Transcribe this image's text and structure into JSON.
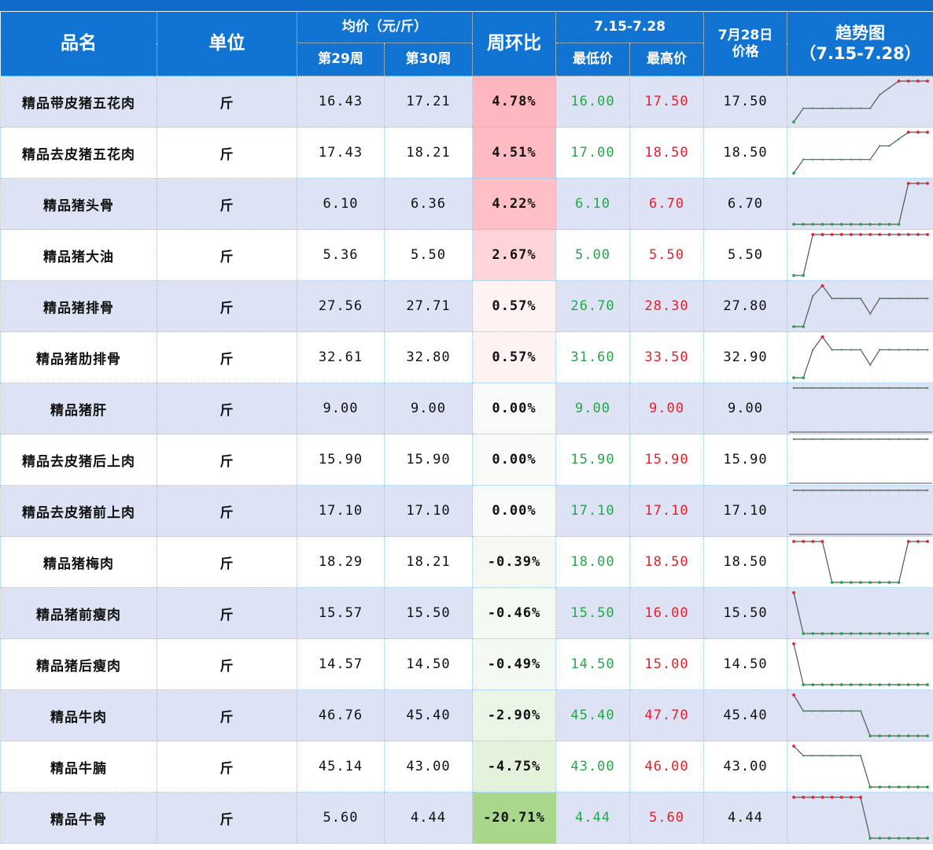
{
  "header": {
    "name": "品名",
    "unit": "单位",
    "avg": "均价（元/斤）",
    "week29": "第29周",
    "week30": "第30周",
    "change": "周环比",
    "range": "7.15-7.28",
    "min": "最低价",
    "max": "最高价",
    "day_line1": "7月28日",
    "day_line2": "价格",
    "trend_line1": "趋势图",
    "trend_line2": "（7.15-7.28）"
  },
  "colors": {
    "header_bg": "#1174d3",
    "row_band": "#dde3f4",
    "min_price": "#22a849",
    "max_price": "#e5202a",
    "positive_change": "#f5b3bb",
    "negative_change": "#a8d88a"
  },
  "rows": [
    {
      "name": "精品带皮猪五花肉",
      "unit": "斤",
      "w29": "16.43",
      "w30": "17.21",
      "change": "4.78%",
      "min": "16.00",
      "max": "17.50",
      "day": "17.50",
      "trend": [
        16.0,
        16.5,
        16.5,
        16.5,
        16.5,
        16.5,
        16.5,
        16.5,
        16.5,
        17.0,
        17.25,
        17.5,
        17.5,
        17.5,
        17.5
      ]
    },
    {
      "name": "精品去皮猪五花肉",
      "unit": "斤",
      "w29": "17.43",
      "w30": "18.21",
      "change": "4.51%",
      "min": "17.00",
      "max": "18.50",
      "day": "18.50",
      "trend": [
        17.0,
        17.5,
        17.5,
        17.5,
        17.5,
        17.5,
        17.5,
        17.5,
        17.5,
        18.0,
        18.0,
        18.25,
        18.5,
        18.5,
        18.5
      ]
    },
    {
      "name": "精品猪头骨",
      "unit": "斤",
      "w29": "6.10",
      "w30": "6.36",
      "change": "4.22%",
      "min": "6.10",
      "max": "6.70",
      "day": "6.70",
      "trend": [
        6.1,
        6.1,
        6.1,
        6.1,
        6.1,
        6.1,
        6.1,
        6.1,
        6.1,
        6.1,
        6.1,
        6.1,
        6.7,
        6.7,
        6.7
      ]
    },
    {
      "name": "精品猪大油",
      "unit": "斤",
      "w29": "5.36",
      "w30": "5.50",
      "change": "2.67%",
      "min": "5.00",
      "max": "5.50",
      "day": "5.50",
      "trend": [
        5.0,
        5.0,
        5.5,
        5.5,
        5.5,
        5.5,
        5.5,
        5.5,
        5.5,
        5.5,
        5.5,
        5.5,
        5.5,
        5.5,
        5.5
      ]
    },
    {
      "name": "精品猪排骨",
      "unit": "斤",
      "w29": "27.56",
      "w30": "27.71",
      "change": "0.57%",
      "min": "26.70",
      "max": "28.30",
      "day": "27.80",
      "trend": [
        26.7,
        26.7,
        27.9,
        28.3,
        27.8,
        27.8,
        27.8,
        27.8,
        27.2,
        27.8,
        27.8,
        27.8,
        27.8,
        27.8,
        27.8
      ]
    },
    {
      "name": "精品猪肋排骨",
      "unit": "斤",
      "w29": "32.61",
      "w30": "32.80",
      "change": "0.57%",
      "min": "31.60",
      "max": "33.50",
      "day": "32.90",
      "trend": [
        31.6,
        31.6,
        32.9,
        33.5,
        32.9,
        32.9,
        32.9,
        32.9,
        32.2,
        32.9,
        32.9,
        32.9,
        32.9,
        32.9,
        32.9
      ]
    },
    {
      "name": "精品猪肝",
      "unit": "斤",
      "w29": "9.00",
      "w30": "9.00",
      "change": "0.00%",
      "min": "9.00",
      "max": "9.00",
      "day": "9.00",
      "trend": [
        9.0,
        9.0,
        9.0,
        9.0,
        9.0,
        9.0,
        9.0,
        9.0,
        9.0,
        9.0,
        9.0,
        9.0,
        9.0,
        9.0,
        9.0
      ]
    },
    {
      "name": "精品去皮猪后上肉",
      "unit": "斤",
      "w29": "15.90",
      "w30": "15.90",
      "change": "0.00%",
      "min": "15.90",
      "max": "15.90",
      "day": "15.90",
      "trend": [
        15.9,
        15.9,
        15.9,
        15.9,
        15.9,
        15.9,
        15.9,
        15.9,
        15.9,
        15.9,
        15.9,
        15.9,
        15.9,
        15.9,
        15.9
      ]
    },
    {
      "name": "精品去皮猪前上肉",
      "unit": "斤",
      "w29": "17.10",
      "w30": "17.10",
      "change": "0.00%",
      "min": "17.10",
      "max": "17.10",
      "day": "17.10",
      "trend": [
        17.1,
        17.1,
        17.1,
        17.1,
        17.1,
        17.1,
        17.1,
        17.1,
        17.1,
        17.1,
        17.1,
        17.1,
        17.1,
        17.1,
        17.1
      ]
    },
    {
      "name": "精品猪梅肉",
      "unit": "斤",
      "w29": "18.29",
      "w30": "18.21",
      "change": "-0.39%",
      "min": "18.00",
      "max": "18.50",
      "day": "18.50",
      "trend": [
        18.5,
        18.5,
        18.5,
        18.5,
        18.0,
        18.0,
        18.0,
        18.0,
        18.0,
        18.0,
        18.0,
        18.0,
        18.5,
        18.5,
        18.5
      ]
    },
    {
      "name": "精品猪前瘦肉",
      "unit": "斤",
      "w29": "15.57",
      "w30": "15.50",
      "change": "-0.46%",
      "min": "15.50",
      "max": "16.00",
      "day": "15.50",
      "trend": [
        16.0,
        15.5,
        15.5,
        15.5,
        15.5,
        15.5,
        15.5,
        15.5,
        15.5,
        15.5,
        15.5,
        15.5,
        15.5,
        15.5,
        15.5
      ]
    },
    {
      "name": "精品猪后瘦肉",
      "unit": "斤",
      "w29": "14.57",
      "w30": "14.50",
      "change": "-0.49%",
      "min": "14.50",
      "max": "15.00",
      "day": "14.50",
      "trend": [
        15.0,
        14.5,
        14.5,
        14.5,
        14.5,
        14.5,
        14.5,
        14.5,
        14.5,
        14.5,
        14.5,
        14.5,
        14.5,
        14.5,
        14.5
      ]
    },
    {
      "name": "精品牛肉",
      "unit": "斤",
      "w29": "46.76",
      "w30": "45.40",
      "change": "-2.90%",
      "min": "45.40",
      "max": "47.70",
      "day": "45.40",
      "trend": [
        47.7,
        46.8,
        46.8,
        46.8,
        46.8,
        46.8,
        46.8,
        46.8,
        45.4,
        45.4,
        45.4,
        45.4,
        45.4,
        45.4,
        45.4
      ]
    },
    {
      "name": "精品牛腩",
      "unit": "斤",
      "w29": "45.14",
      "w30": "43.00",
      "change": "-4.75%",
      "min": "43.00",
      "max": "46.00",
      "day": "43.00",
      "trend": [
        46.0,
        45.3,
        45.3,
        45.3,
        45.3,
        45.3,
        45.3,
        45.3,
        43.0,
        43.0,
        43.0,
        43.0,
        43.0,
        43.0,
        43.0
      ]
    },
    {
      "name": "精品牛骨",
      "unit": "斤",
      "w29": "5.60",
      "w30": "4.44",
      "change": "-20.71%",
      "min": "4.44",
      "max": "5.60",
      "day": "4.44",
      "trend": [
        5.6,
        5.6,
        5.6,
        5.6,
        5.6,
        5.6,
        5.6,
        5.6,
        4.44,
        4.44,
        4.44,
        4.44,
        4.44,
        4.44,
        4.44
      ]
    }
  ]
}
